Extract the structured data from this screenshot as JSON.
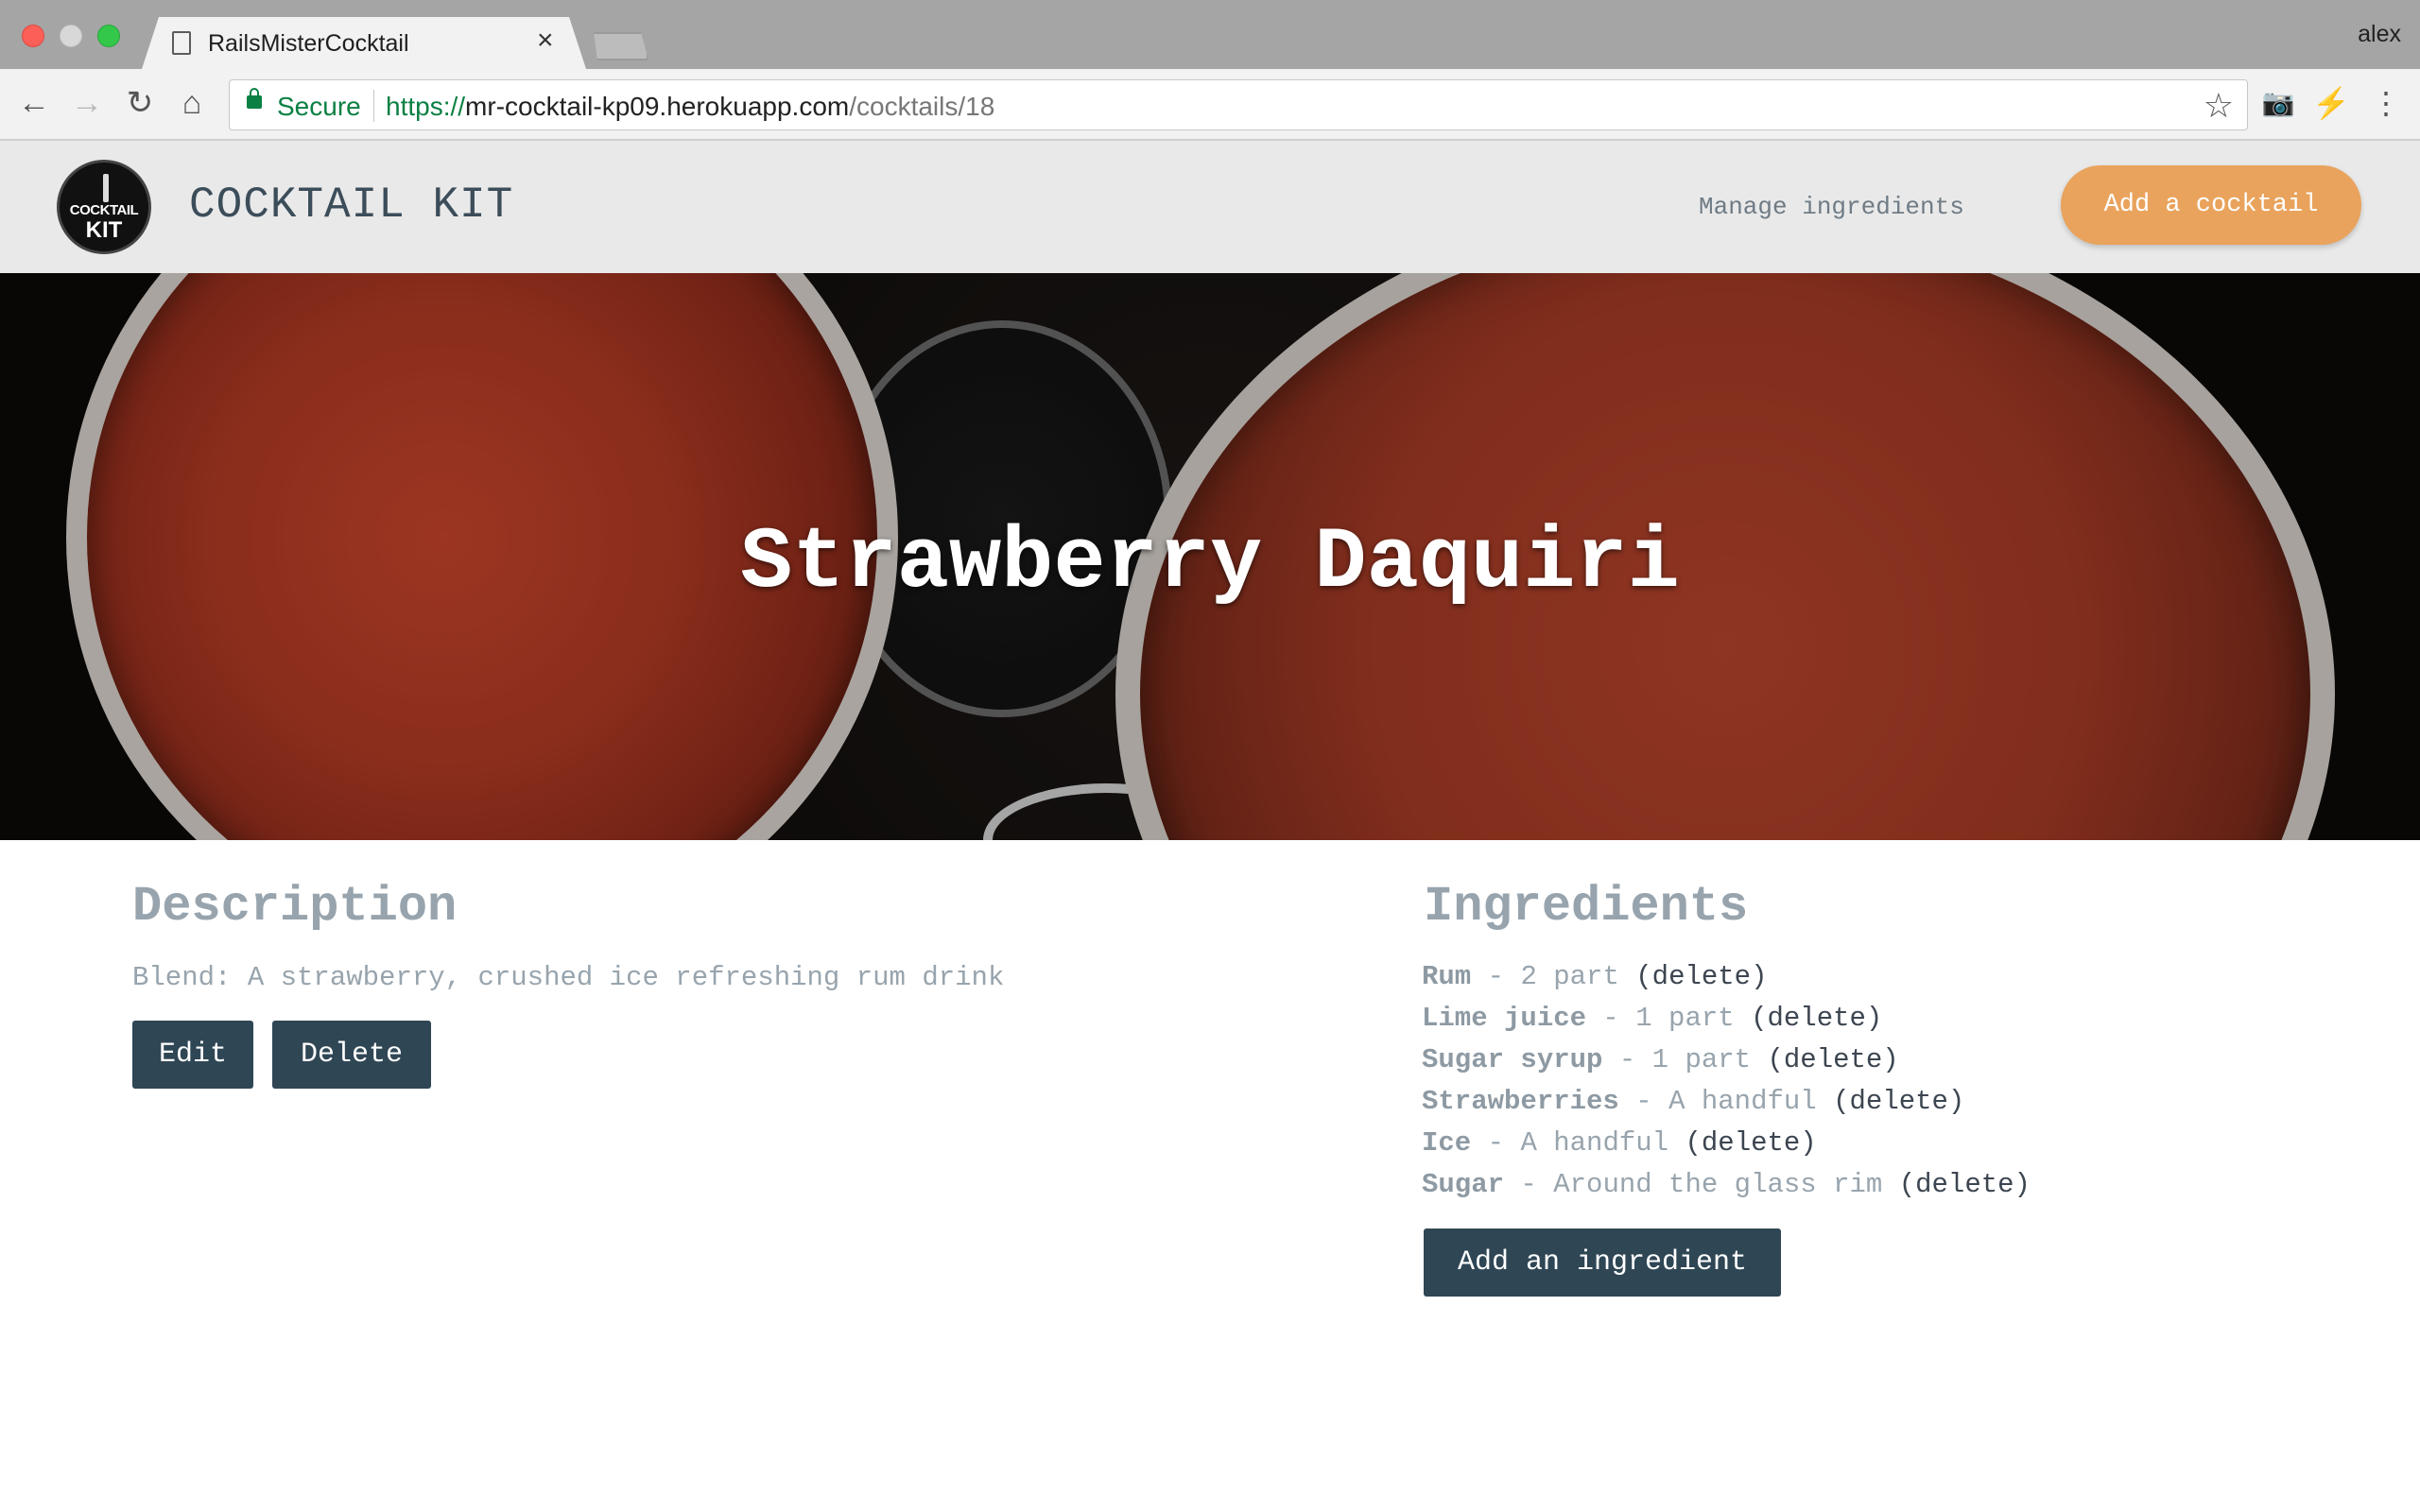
{
  "browser": {
    "tab_title": "RailsMisterCocktail",
    "tab_close": "×",
    "profile": "alex",
    "secure_label": "Secure",
    "url_scheme": "https://",
    "url_host": "mr-cocktail-kp09.herokuapp.com",
    "url_path": "/cocktails/18",
    "icons": {
      "back": "←",
      "forward": "→",
      "reload": "↻",
      "home": "⌂",
      "star": "☆",
      "camera": "📷",
      "extension": "⚡",
      "menu": "⋮"
    }
  },
  "header": {
    "logo_line1": "COCKTAIL",
    "logo_line2": "KIT",
    "brand": "COCKTAIL KIT",
    "nav_link": "Manage ingredients",
    "cta": "Add a cocktail",
    "cta_color": "#e9a35c"
  },
  "hero": {
    "title": "Strawberry Daquiri"
  },
  "description": {
    "heading": "Description",
    "text": "Blend: A strawberry, crushed ice refreshing rum drink",
    "edit_label": "Edit",
    "delete_label": "Delete"
  },
  "ingredients": {
    "heading": "Ingredients",
    "separator": " - ",
    "delete_label": "(delete)",
    "items": [
      {
        "name": "Rum",
        "amount": "2 part"
      },
      {
        "name": "Lime juice",
        "amount": "1 part"
      },
      {
        "name": "Sugar syrup",
        "amount": "1 part"
      },
      {
        "name": "Strawberries",
        "amount": "A handful"
      },
      {
        "name": "Ice",
        "amount": "A handful"
      },
      {
        "name": "Sugar",
        "amount": "Around the glass rim"
      }
    ],
    "add_label": "Add an ingredient"
  },
  "colors": {
    "button_dark": "#2f4655",
    "muted_text": "#98a4ad"
  }
}
